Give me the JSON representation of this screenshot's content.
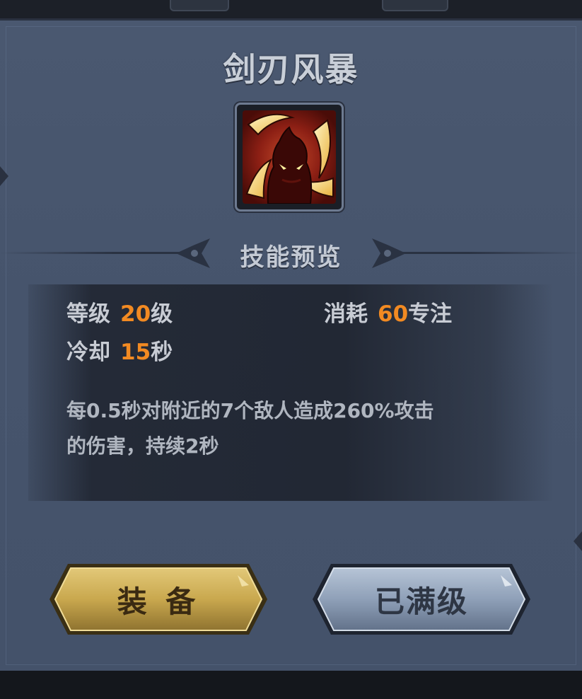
{
  "skill": {
    "name": "剑刃风暴",
    "icon": "blade-storm-skill-icon"
  },
  "section": {
    "title": "技能预览"
  },
  "stats": {
    "level_label": "等级",
    "level_value": "20",
    "level_unit": "级",
    "cost_label": "消耗",
    "cost_value": "60",
    "cost_unit": "专注",
    "cooldown_label": "冷却",
    "cooldown_value": "15",
    "cooldown_unit": "秒"
  },
  "description": {
    "line1": "每0.5秒对附近的7个敌人造成260%攻击",
    "line2": "的伤害，持续2秒"
  },
  "buttons": {
    "equip_label": "装 备",
    "maxed_label": "已满级"
  },
  "colors": {
    "accent_number": "#f28a22",
    "panel": "#4a5870",
    "equip_gold": "#c9a84e",
    "maxed_steel": "#8fa0b8"
  }
}
